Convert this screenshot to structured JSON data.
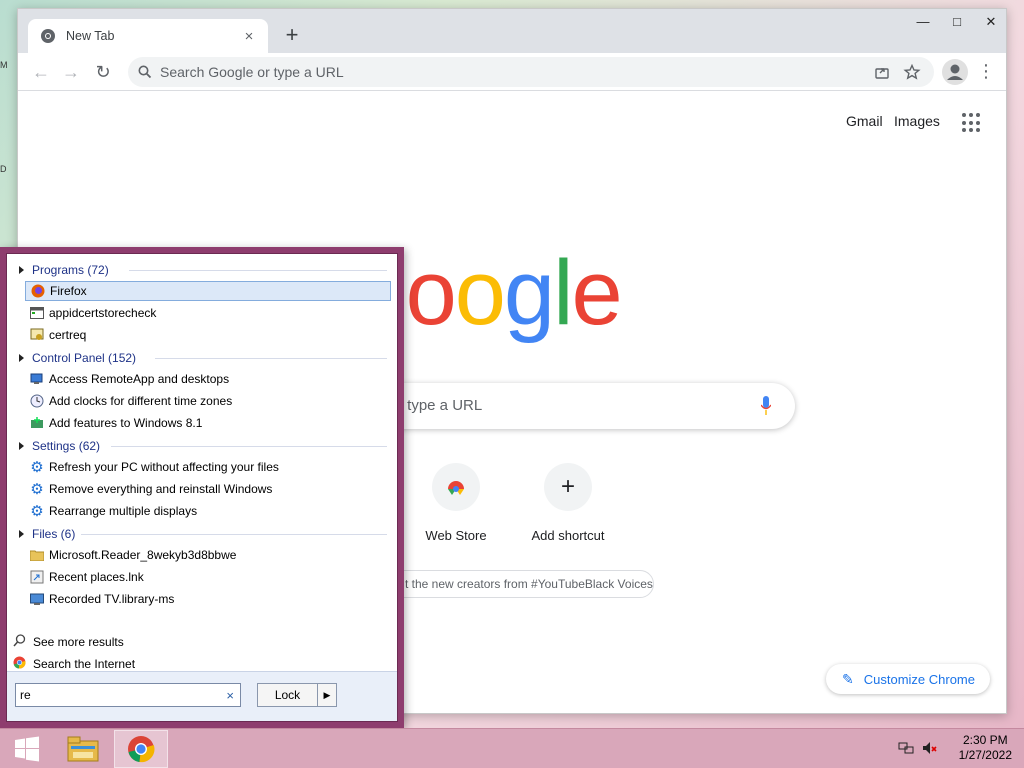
{
  "desktop": {
    "edge_glyph_1": "M",
    "edge_glyph_2": "D"
  },
  "browser": {
    "tab_title": "New Tab",
    "tab_close": "×",
    "new_tab": "+",
    "window_controls": {
      "minimize": "—",
      "maximize": "□",
      "close": "✕"
    },
    "nav": {
      "back": "←",
      "forward": "→",
      "reload": "↻"
    },
    "omnibox_placeholder": "Search Google or type a URL",
    "header_links": {
      "gmail": "Gmail",
      "images": "Images"
    },
    "search_placeholder": "r type a URL",
    "shortcuts": [
      {
        "label": "Web Store"
      },
      {
        "label": "Add shortcut",
        "glyph": "+"
      }
    ],
    "promo_text": "t the new creators from #YouTubeBlack Voices",
    "customize_label": "Customize Chrome",
    "colors": {
      "blue": "#4285f4",
      "red": "#ea4335",
      "yellow": "#fbbc05",
      "green": "#34a853"
    }
  },
  "startmenu": {
    "categories": [
      {
        "label": "Programs (72)",
        "items": [
          {
            "label": "Firefox",
            "icon": "firefox-icon",
            "selected": true
          },
          {
            "label": "appidcertstorecheck",
            "icon": "console-app-icon"
          },
          {
            "label": "certreq",
            "icon": "certificate-icon"
          }
        ]
      },
      {
        "label": "Control Panel (152)",
        "items": [
          {
            "label": "Access RemoteApp and desktops",
            "icon": "remote-desktop-icon"
          },
          {
            "label": "Add clocks for different time zones",
            "icon": "clock-icon"
          },
          {
            "label": "Add features to Windows 8.1",
            "icon": "add-features-icon"
          }
        ]
      },
      {
        "label": "Settings (62)",
        "items": [
          {
            "label": "Refresh your PC without affecting your files",
            "icon": "gear-icon"
          },
          {
            "label": "Remove everything and reinstall Windows",
            "icon": "gear-icon"
          },
          {
            "label": "Rearrange multiple displays",
            "icon": "gear-icon"
          }
        ]
      },
      {
        "label": "Files (6)",
        "items": [
          {
            "label": "Microsoft.Reader_8wekyb3d8bbwe",
            "icon": "folder-icon"
          },
          {
            "label": "Recent places.lnk",
            "icon": "shortcut-icon"
          },
          {
            "label": "Recorded TV.library-ms",
            "icon": "library-icon"
          }
        ]
      }
    ],
    "see_more": "See more results",
    "search_internet": "Search the Internet",
    "search_value": "re",
    "clear_glyph": "×",
    "lock_label": "Lock",
    "lock_arrow": "▶"
  },
  "taskbar": {
    "time": "2:30 PM",
    "date": "1/27/2022"
  }
}
